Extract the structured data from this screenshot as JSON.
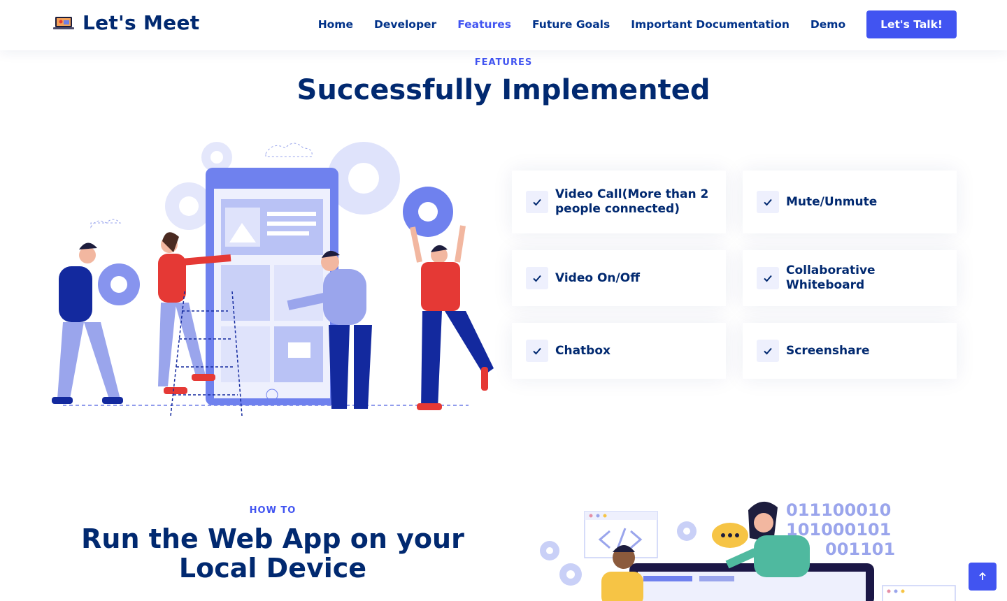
{
  "header": {
    "logo_text": "Let's Meet",
    "nav": [
      {
        "label": "Home",
        "active": false
      },
      {
        "label": "Developer",
        "active": false
      },
      {
        "label": "Features",
        "active": true
      },
      {
        "label": "Future Goals",
        "active": false
      },
      {
        "label": "Important Documentation",
        "active": false
      },
      {
        "label": "Demo",
        "active": false
      }
    ],
    "cta_label": "Let's Talk!"
  },
  "features": {
    "kicker": "FEATURES",
    "title": "Successfully Implemented",
    "items": [
      {
        "label": "Video Call(More than 2 people connected)"
      },
      {
        "label": "Mute/Unmute"
      },
      {
        "label": "Video On/Off"
      },
      {
        "label": "Collaborative Whiteboard"
      },
      {
        "label": "Chatbox"
      },
      {
        "label": "Screenshare"
      }
    ]
  },
  "howto": {
    "kicker": "HOW TO",
    "title": "Run the Web App on your Local Device",
    "binary": [
      "011100010",
      "101000101",
      "001101"
    ]
  },
  "colors": {
    "accent": "#4154f1",
    "navy": "#012970",
    "red": "#e53935"
  },
  "icons": {
    "check": "check-icon",
    "back_to_top": "arrow-up-icon"
  }
}
